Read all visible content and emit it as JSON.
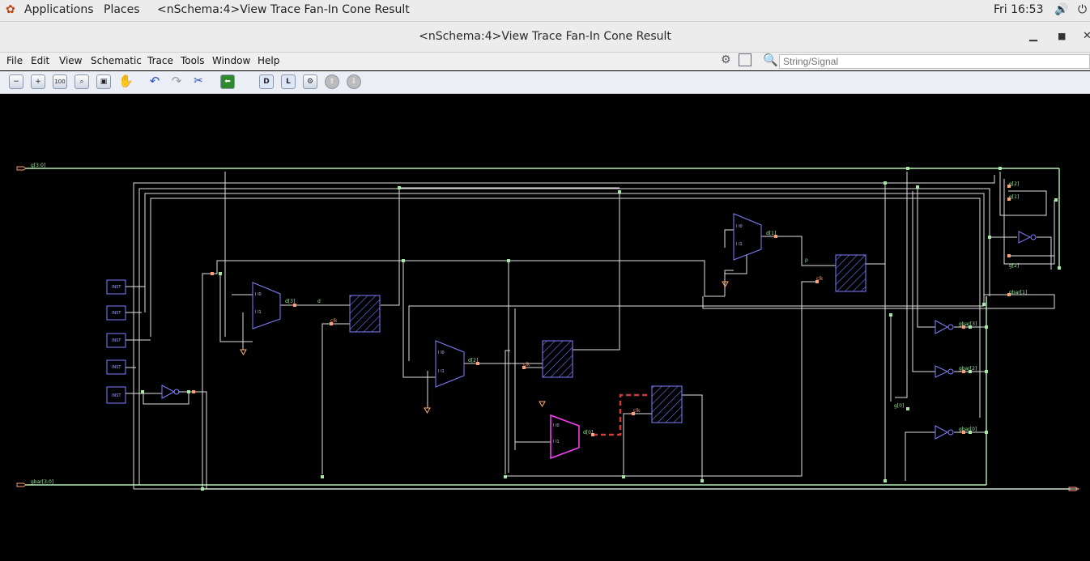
{
  "topbar": {
    "applications": "Applications",
    "places": "Places",
    "window_title": "<nSchema:4>View Trace Fan-In Cone Result",
    "clock": "Fri 16:53"
  },
  "window": {
    "title": "<nSchema:4>View Trace Fan-In Cone Result"
  },
  "menu": {
    "file": "File",
    "edit": "Edit",
    "view": "View",
    "schematic": "Schematic",
    "trace": "Trace",
    "tools": "Tools",
    "window": "Window",
    "help": "Help"
  },
  "search": {
    "placeholder": "String/Signal"
  },
  "toolbar": {
    "zoom100": "100",
    "d_label": "D",
    "l_label": "L"
  },
  "schematic": {
    "ports": {
      "g_in": "g[3:0]",
      "gbar_in": "gbar[3:0]"
    },
    "inst": "INST",
    "nets": {
      "d": "d",
      "d3": "d[3]",
      "d2": "d[2]",
      "d1": "d[1]",
      "d0": "d[0]",
      "clk": "clk",
      "p": "p",
      "g0": "g[0]",
      "g1": "g[1]",
      "g2": "g[2]",
      "g3": "g[3]",
      "gbar1": "gbar[1]",
      "gbar2": "gbar[2]",
      "gbar3": "gbar[3]",
      "gbar0": "gbar[0]"
    },
    "mux": {
      "i0": "I I0",
      "i1": "I I1"
    }
  },
  "colors": {
    "wire": "#e8e8e8",
    "port": "#a8e6a8",
    "label": "#9fe29f",
    "clk": "#ff9f7a",
    "cell": "#8080ff",
    "highlight": "#ff40ff",
    "trace": "#d04040"
  }
}
